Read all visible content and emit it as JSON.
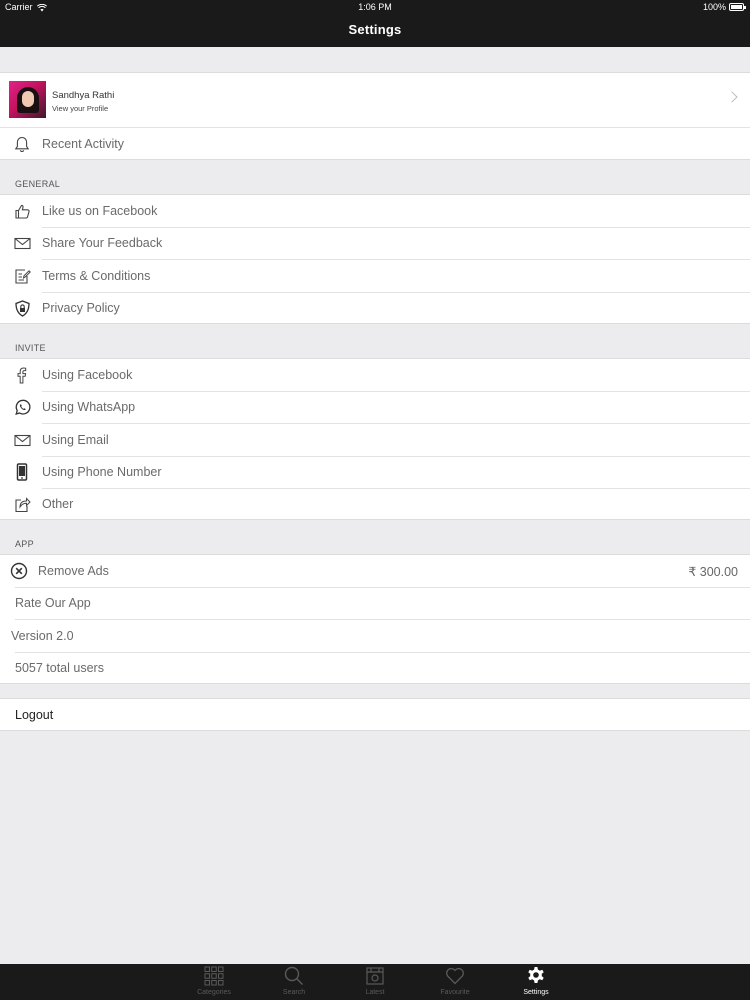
{
  "status_bar": {
    "carrier": "Carrier",
    "time": "1:06 PM",
    "battery": "100%"
  },
  "nav": {
    "title": "Settings"
  },
  "profile": {
    "name": "Sandhya Rathi",
    "subtitle": "View your Profile"
  },
  "recent_activity": {
    "label": "Recent Activity",
    "icon": "bell-icon"
  },
  "general": {
    "header": "GENERAL",
    "items": [
      {
        "label": "Like us on Facebook",
        "icon": "thumbs-up-icon"
      },
      {
        "label": "Share Your Feedback",
        "icon": "envelope-icon"
      },
      {
        "label": "Terms & Conditions",
        "icon": "edit-document-icon"
      },
      {
        "label": "Privacy Policy",
        "icon": "shield-lock-icon"
      }
    ]
  },
  "invite": {
    "header": "INVITE",
    "items": [
      {
        "label": "Using Facebook",
        "icon": "facebook-icon"
      },
      {
        "label": "Using WhatsApp",
        "icon": "whatsapp-icon"
      },
      {
        "label": "Using Email",
        "icon": "envelope-icon"
      },
      {
        "label": "Using Phone Number",
        "icon": "phone-icon"
      },
      {
        "label": "Other",
        "icon": "share-icon"
      }
    ]
  },
  "app": {
    "header": "APP",
    "remove_ads": {
      "label": "Remove Ads",
      "price": "₹ 300.00",
      "icon": "close-circle-icon"
    },
    "rate": "Rate Our App",
    "version": "Version 2.0",
    "users": "5057 total users"
  },
  "logout": "Logout",
  "tabs": [
    {
      "label": "Categories",
      "icon": "grid-icon",
      "active": false
    },
    {
      "label": "Search",
      "icon": "search-icon",
      "active": false
    },
    {
      "label": "Latest",
      "icon": "latest-icon",
      "active": false
    },
    {
      "label": "Favourite",
      "icon": "heart-icon",
      "active": false
    },
    {
      "label": "Settings",
      "icon": "gear-icon",
      "active": true
    }
  ],
  "colors": {
    "bar_background": "#1a1a1a",
    "page_background": "#ececef",
    "active_tab": "#ffffff",
    "inactive_tab": "#5a5a5a"
  }
}
